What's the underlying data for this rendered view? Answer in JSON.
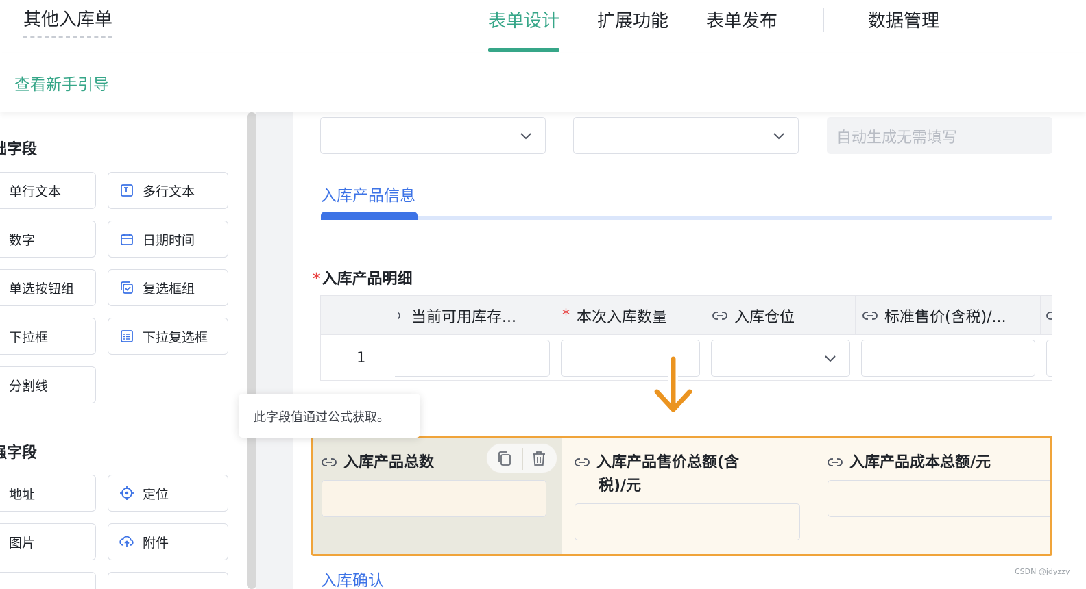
{
  "header": {
    "form_title": "其他入库单",
    "tabs": [
      {
        "label": "表单设计",
        "active": true
      },
      {
        "label": "扩展功能",
        "active": false
      },
      {
        "label": "表单发布",
        "active": false
      },
      {
        "label": "数据管理",
        "active": false
      }
    ],
    "guide_link": "查看新手引导"
  },
  "colors": {
    "accent_green": "#36a688",
    "accent_blue": "#3d73e6",
    "highlight_orange": "#f0a43a",
    "required_red": "#e84040"
  },
  "left_panel": {
    "basic_section_title": "础字段",
    "basic_fields": [
      {
        "label": "单行文本",
        "icon": "single-line-text-icon"
      },
      {
        "label": "多行文本",
        "icon": "multi-line-text-icon"
      },
      {
        "label": "数字",
        "icon": "number-icon"
      },
      {
        "label": "日期时间",
        "icon": "calendar-icon"
      },
      {
        "label": "单选按钮组",
        "icon": "radio-icon"
      },
      {
        "label": "复选框组",
        "icon": "checkbox-icon"
      },
      {
        "label": "下拉框",
        "icon": "dropdown-icon"
      },
      {
        "label": "下拉复选框",
        "icon": "dropdown-checklist-icon"
      },
      {
        "label": "分割线",
        "icon": "divider-icon"
      }
    ],
    "advanced_section_title": "强字段",
    "advanced_fields": [
      {
        "label": "地址",
        "icon": "address-icon"
      },
      {
        "label": "定位",
        "icon": "location-target-icon"
      },
      {
        "label": "图片",
        "icon": "image-icon"
      },
      {
        "label": "附件",
        "icon": "upload-cloud-icon"
      }
    ]
  },
  "canvas": {
    "auto_placeholder": "自动生成无需填写",
    "subtab_label": "入库产品信息",
    "table_title": "入库产品明细",
    "table_columns": [
      {
        "label": "当前可用库存...",
        "kind": "formula"
      },
      {
        "label": "本次入库数量",
        "kind": "required"
      },
      {
        "label": "入库仓位",
        "kind": "formula"
      },
      {
        "label": "标准售价(含税)/...",
        "kind": "formula"
      }
    ],
    "row_number": "1",
    "tooltip": "此字段值通过公式获取。",
    "group_fields": [
      {
        "label": "入库产品总数"
      },
      {
        "label_line1": "入库产品售价总额(含",
        "label_line2": "税)/元"
      },
      {
        "label": "入库产品成本总额/元"
      }
    ],
    "next_section": "入库确认"
  },
  "watermark": "CSDN @jdyzzy"
}
